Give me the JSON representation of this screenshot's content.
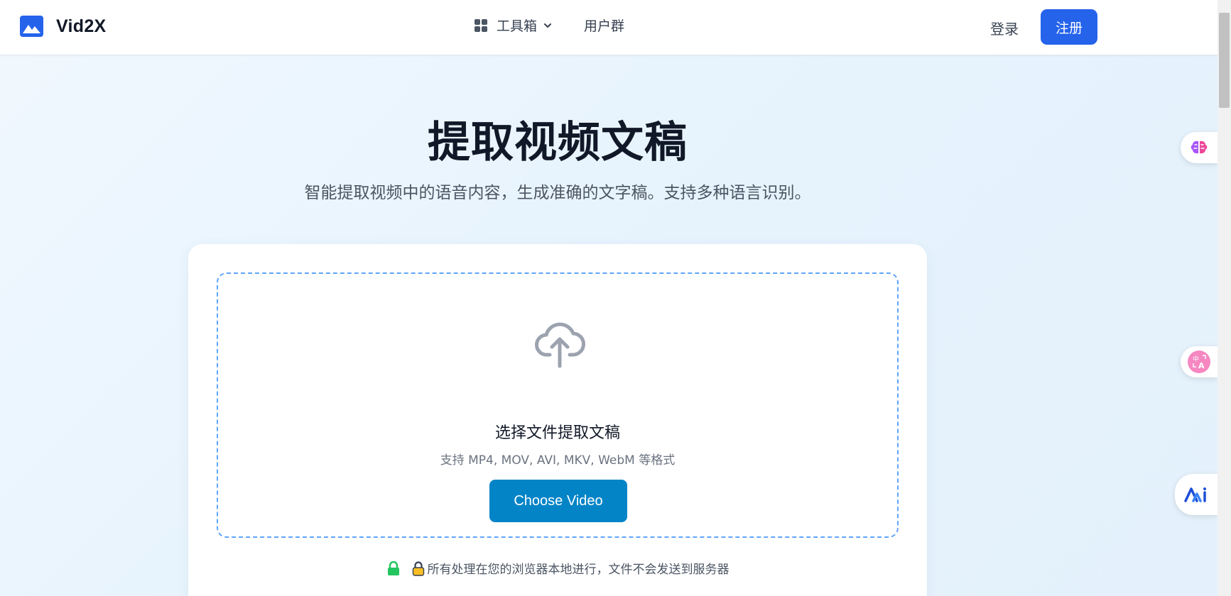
{
  "header": {
    "logo_text": "Vid2X",
    "nav": {
      "toolbox_label": "工具箱",
      "group_label": "用户群"
    },
    "login_label": "登录",
    "register_label": "注册"
  },
  "hero": {
    "title": "提取视频文稿",
    "subtitle": "智能提取视频中的语音内容，生成准确的文字稿。支持多种语言识别。"
  },
  "upload": {
    "title": "选择文件提取文稿",
    "formats": "支持 MP4, MOV, AVI, MKV, WebM 等格式",
    "button_label": "Choose Video",
    "privacy_note": "所有处理在您的浏览器本地进行，文件不会发送到服务器"
  },
  "icons": {
    "logo": "mountain-image-icon",
    "toolbox": "grid-icon",
    "upload": "cloud-upload-icon",
    "privacy": "lock-icon",
    "float_1": "brain-icon",
    "float_2": "translate-icon",
    "float_3": "ai-assistant-icon"
  },
  "colors": {
    "primary": "#2563eb",
    "choose_button": "#0284c7",
    "dropzone_border": "#60a5fa",
    "lock_green": "#22c55e",
    "lock_yellow": "#fbbf24"
  }
}
